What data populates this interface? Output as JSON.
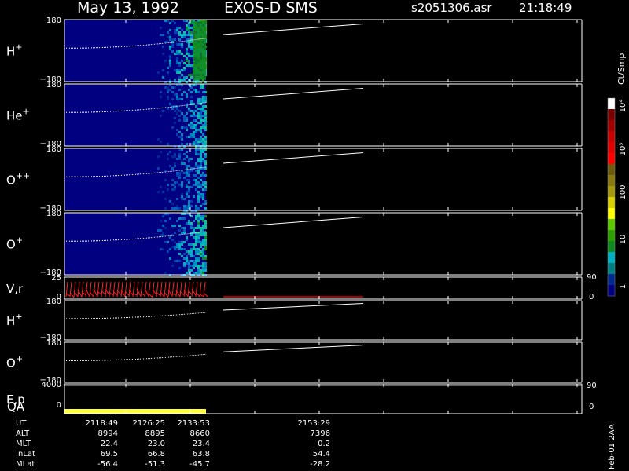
{
  "header": {
    "date": "May 13, 1992",
    "instrument": "EXOS-D SMS",
    "file": "s2051306.asr",
    "time": "21:18:49"
  },
  "colorbar": {
    "label": "Ct/Smp",
    "ticks": [
      "10⁴",
      "10³",
      "100",
      "10",
      "1"
    ],
    "colors": [
      "#ffffff",
      "#7a0000",
      "#a00000",
      "#c80000",
      "#e00000",
      "#ff0000",
      "#6b5a10",
      "#8a7a10",
      "#a89a10",
      "#d8d000",
      "#ffff00",
      "#60c800",
      "#30a000",
      "#108a20",
      "#00b0c0",
      "#008080",
      "#002a90",
      "#000080"
    ]
  },
  "footer_note": "Feb-01 2AA",
  "chart_data": {
    "type": "heatmap",
    "time_axis": {
      "ut_ticks": [
        "2118:49",
        "2126:25",
        "2133:53",
        "2153:29"
      ],
      "rows": [
        {
          "name": "UT",
          "values": [
            "2118:49",
            "2126:25",
            "2133:53",
            "2153:29"
          ]
        },
        {
          "name": "ALT",
          "values": [
            "8994",
            "8895",
            "8660",
            "7396"
          ]
        },
        {
          "name": "MLT",
          "values": [
            "22.4",
            "23.0",
            "23.4",
            "0.2"
          ]
        },
        {
          "name": "InLat",
          "values": [
            "69.5",
            "66.8",
            "63.8",
            "54.4"
          ]
        },
        {
          "name": "MLat",
          "values": [
            "-56.4",
            "-51.3",
            "-45.7",
            "-28.2"
          ]
        }
      ]
    },
    "panels": [
      {
        "name": "H+",
        "ymax": "180",
        "ymin": "−180",
        "kind": "spectrogram",
        "intensity": 0.9
      },
      {
        "name": "He+",
        "ymax": "180",
        "ymin": "−180",
        "kind": "spectrogram",
        "intensity": 0.65
      },
      {
        "name": "O++",
        "ymax": "180",
        "ymin": "−180",
        "kind": "spectrogram",
        "intensity": 0.6
      },
      {
        "name": "O+",
        "ymax": "180",
        "ymin": "−180",
        "kind": "spectrogram",
        "intensity": 0.75
      },
      {
        "name": "V,r",
        "ymax": "25",
        "ymin": "0",
        "right_max": "90",
        "right_min": "0",
        "kind": "velocity"
      },
      {
        "name": "H+",
        "ymax": "180",
        "ymin": "−180",
        "kind": "line"
      },
      {
        "name": "O+",
        "ymax": "180",
        "ymin": "−180",
        "kind": "line"
      },
      {
        "name": "E,p",
        "ymax": "4000",
        "ymin": "0",
        "right_max": "90",
        "right_min": "0",
        "kind": "qa"
      }
    ],
    "qa_label": "QA"
  }
}
